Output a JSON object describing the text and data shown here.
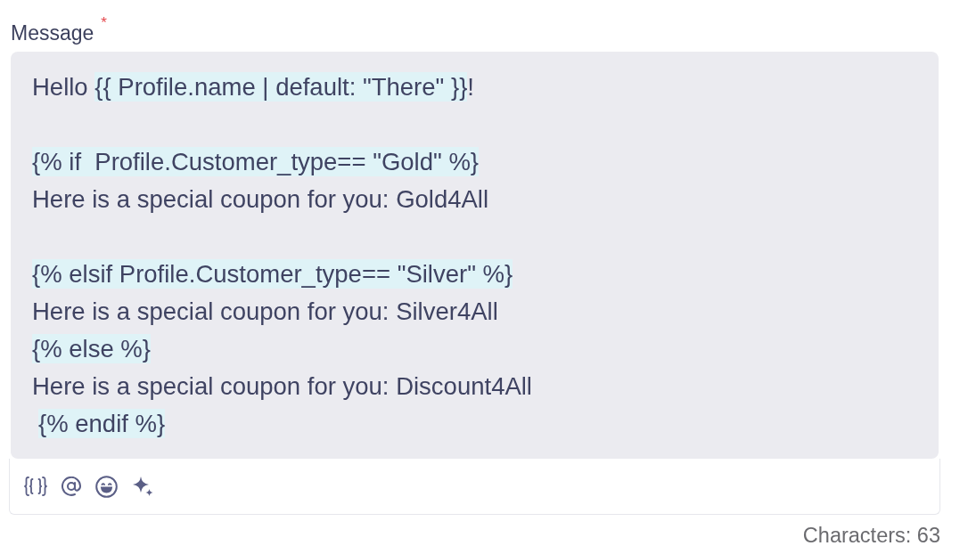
{
  "field": {
    "label": "Message",
    "required_mark": "*"
  },
  "message": {
    "lines": [
      {
        "kind": "text",
        "indented": false,
        "segments": [
          {
            "kind": "plain",
            "text": "Hello "
          },
          {
            "kind": "variable",
            "text": "{{ Profile.name | default: \"There\" }}"
          },
          {
            "kind": "plain",
            "text": "!"
          }
        ]
      },
      {
        "kind": "blank"
      },
      {
        "kind": "text",
        "indented": false,
        "segments": [
          {
            "kind": "tag",
            "text": "{% if  Profile.Customer_type== \"Gold\" %}"
          }
        ]
      },
      {
        "kind": "text",
        "indented": false,
        "segments": [
          {
            "kind": "plain",
            "text": "Here is a special coupon for you: Gold4All"
          }
        ]
      },
      {
        "kind": "blank"
      },
      {
        "kind": "text",
        "indented": false,
        "segments": [
          {
            "kind": "tag",
            "text": "{% elsif Profile.Customer_type== \"Silver\" %}"
          }
        ]
      },
      {
        "kind": "text",
        "indented": false,
        "segments": [
          {
            "kind": "plain",
            "text": "Here is a special coupon for you: Silver4All"
          }
        ]
      },
      {
        "kind": "text",
        "indented": false,
        "segments": [
          {
            "kind": "tag",
            "text": "{% else %}"
          }
        ]
      },
      {
        "kind": "text",
        "indented": false,
        "segments": [
          {
            "kind": "plain",
            "text": "Here is a special coupon for you: Discount4All"
          }
        ]
      },
      {
        "kind": "text",
        "indented": true,
        "segments": [
          {
            "kind": "tag",
            "text": "{% endif %}"
          }
        ]
      }
    ]
  },
  "character_count": "Characters: 63"
}
